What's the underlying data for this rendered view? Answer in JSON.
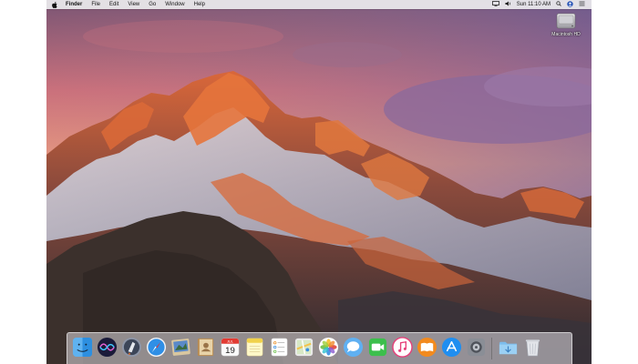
{
  "menubar": {
    "apple_icon": "apple-logo-icon",
    "items": [
      "Finder",
      "File",
      "Edit",
      "View",
      "Go",
      "Window",
      "Help"
    ],
    "clock": "Sun 11:10 AM",
    "status_icons": [
      "display-icon",
      "speaker-icon",
      "search-icon",
      "user-icon",
      "list-icon"
    ]
  },
  "desktop": {
    "drive_label": "Macintosh HD",
    "wallpaper": "Sierra mountain range at sunset"
  },
  "dock": {
    "calendar_month": "JUL",
    "calendar_day": "19",
    "items": [
      "finder-icon",
      "siri-icon",
      "launchpad-icon",
      "safari-icon",
      "mail-photo-icon",
      "contacts-icon",
      "calendar-icon",
      "notes-icon",
      "reminders-icon",
      "maps-icon",
      "photos-icon",
      "messages-icon",
      "facetime-icon",
      "itunes-icon",
      "ibooks-icon",
      "app-store-icon",
      "system-preferences-icon",
      "downloads-folder-icon",
      "trash-icon"
    ]
  },
  "colors": {
    "sky_top": "#6a4a6e",
    "sky_glow": "#e58a6a",
    "cloud": "#8d6a9a",
    "peak_lit": "#e0703a",
    "rock_dark": "#3a2f2c",
    "snow": "#c9cbd8"
  }
}
